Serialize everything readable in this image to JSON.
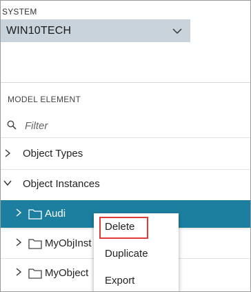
{
  "system": {
    "label": "SYSTEM",
    "value": "WIN10TECH",
    "chevron_icon": "chevron-down-icon"
  },
  "model_element": {
    "label": "MODEL ELEMENT",
    "filter_placeholder": "Filter",
    "search_icon": "search-icon"
  },
  "tree": {
    "items": [
      {
        "label": "Object Types",
        "expanded": false,
        "level": 0
      },
      {
        "label": "Object Instances",
        "expanded": true,
        "level": 0
      },
      {
        "label": "Audi",
        "expanded": false,
        "level": 1,
        "selected": true,
        "icon": "folder-icon"
      },
      {
        "label": "MyObjInst",
        "expanded": false,
        "level": 1,
        "icon": "folder-icon"
      },
      {
        "label": "MyObject",
        "expanded": false,
        "level": 1,
        "icon": "folder-icon"
      }
    ]
  },
  "context_menu": {
    "items": [
      {
        "label": "Delete",
        "highlighted": true
      },
      {
        "label": "Duplicate"
      },
      {
        "label": "Export"
      }
    ]
  },
  "colors": {
    "selection": "#1d7fa0",
    "select_bg": "#c9d3db",
    "highlight_border": "#e0393a"
  }
}
